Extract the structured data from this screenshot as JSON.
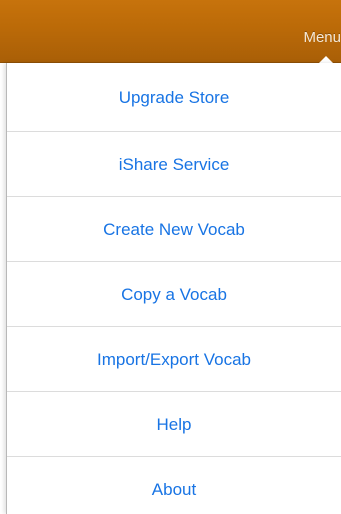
{
  "header": {
    "menu_label": "Menu"
  },
  "menu": {
    "items": [
      {
        "label": "Upgrade Store"
      },
      {
        "label": "iShare Service"
      },
      {
        "label": "Create New Vocab"
      },
      {
        "label": "Copy a Vocab"
      },
      {
        "label": "Import/Export Vocab"
      },
      {
        "label": "Help"
      },
      {
        "label": "About"
      }
    ]
  },
  "colors": {
    "header_bar": "#bb6a08",
    "menu_text": "#1874e4",
    "divider": "#dcdcdc"
  }
}
